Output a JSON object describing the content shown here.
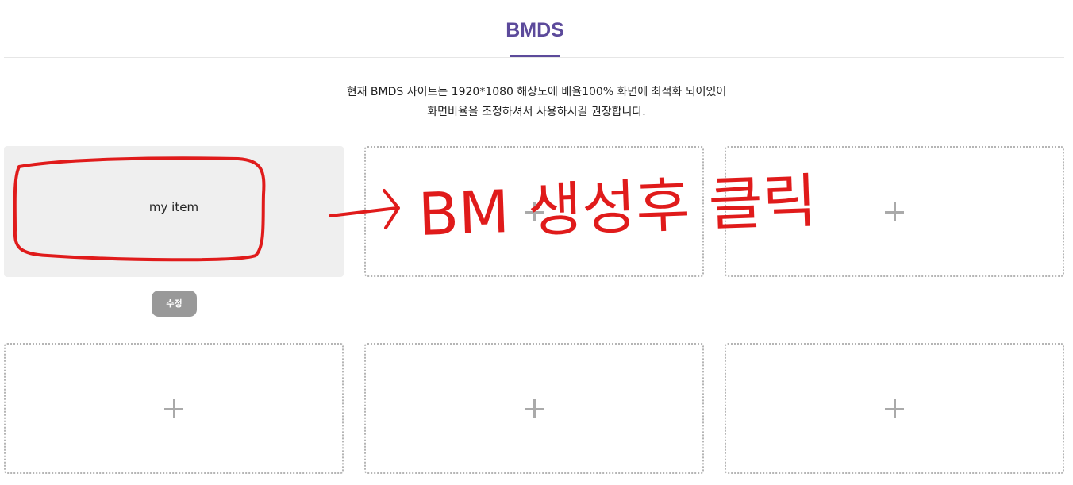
{
  "header": {
    "tab_label": "BMDS",
    "accent_color": "#5c4a9b"
  },
  "notice": {
    "line1": "현재 BMDS 사이트는 1920*1080 해상도에 배율100% 화면에 최적화 되어있어",
    "line2": "화면비율을 조정하셔서 사용하시길 권장합니다."
  },
  "cards": {
    "item1_label": "my item",
    "edit_label": "수정",
    "add_icon": "plus-icon"
  },
  "annotation": {
    "text": "BM 생성후 클릭",
    "color": "#e01b1b"
  }
}
